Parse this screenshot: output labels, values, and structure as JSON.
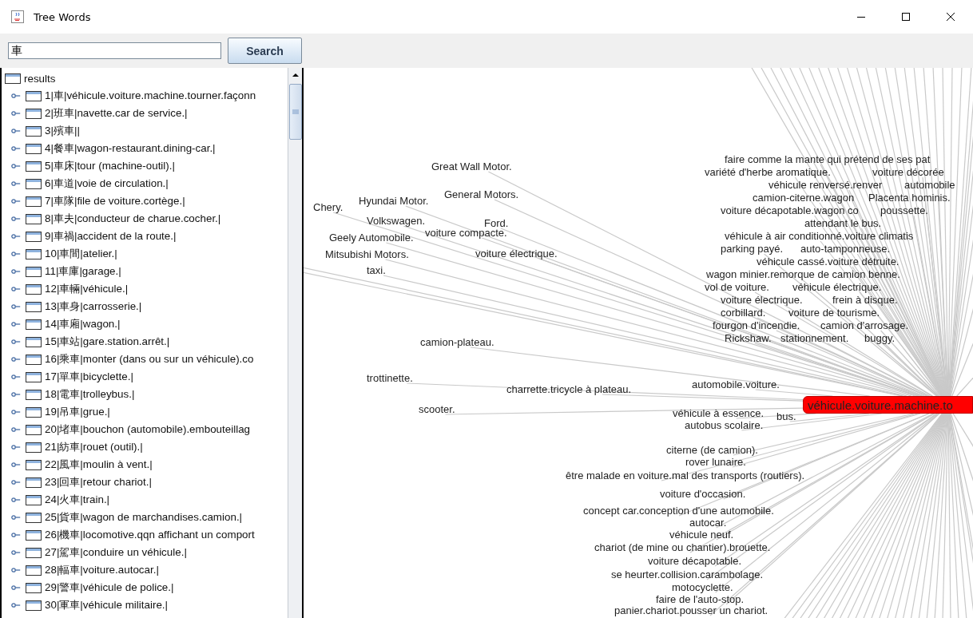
{
  "window": {
    "title": "Tree Words"
  },
  "search": {
    "value": "車",
    "button": "Search"
  },
  "tree": {
    "root": {
      "label": "results",
      "expanded": true,
      "children": [
        {
          "label": "1|車|véhicule.voiture.machine.tourner.façonn",
          "expanded": false
        },
        {
          "label": "2|班車|navette.car de service.|",
          "expanded": false
        },
        {
          "label": "3|殯車||",
          "expanded": false
        },
        {
          "label": "4|餐車|wagon-restaurant.dining-car.|",
          "expanded": false
        },
        {
          "label": "5|車床|tour (machine-outil).|",
          "expanded": false
        },
        {
          "label": "6|車道|voie de circulation.|",
          "expanded": false
        },
        {
          "label": "7|車隊|file de voiture.cortège.|",
          "expanded": false
        },
        {
          "label": "8|車夫|conducteur de charue.cocher.|",
          "expanded": false
        },
        {
          "label": "9|車禍|accident de la route.|",
          "expanded": false
        },
        {
          "label": "10|車間|atelier.|",
          "expanded": false
        },
        {
          "label": "11|車庫|garage.|",
          "expanded": false
        },
        {
          "label": "12|車輛|véhicule.|",
          "expanded": false
        },
        {
          "label": "13|車身|carrosserie.|",
          "expanded": false
        },
        {
          "label": "14|車廂|wagon.|",
          "expanded": false
        },
        {
          "label": "15|車站|gare.station.arrêt.|",
          "expanded": false
        },
        {
          "label": "16|乘車|monter (dans ou sur un véhicule).co",
          "expanded": false
        },
        {
          "label": "17|單車|bicyclette.|",
          "expanded": false
        },
        {
          "label": "18|電車|trolleybus.|",
          "expanded": false
        },
        {
          "label": "19|吊車|grue.|",
          "expanded": false
        },
        {
          "label": "20|堵車|bouchon (automobile).embouteillag",
          "expanded": false
        },
        {
          "label": "21|紡車|rouet (outil).|",
          "expanded": false
        },
        {
          "label": "22|風車|moulin à vent.|",
          "expanded": false
        },
        {
          "label": "23|回車|retour chariot.|",
          "expanded": false
        },
        {
          "label": "24|火車|train.|",
          "expanded": false
        },
        {
          "label": "25|貨車|wagon de marchandises.camion.|",
          "expanded": false
        },
        {
          "label": "26|機車|locomotive.qqn affichant un comport",
          "expanded": false
        },
        {
          "label": "27|駕車|conduire un véhicule.|",
          "expanded": false
        },
        {
          "label": "28|輻車|voiture.autocar.|",
          "expanded": false
        },
        {
          "label": "29|警車|véhicule de police.|",
          "expanded": false
        },
        {
          "label": "30|軍車|véhicule militaire.|",
          "expanded": false
        }
      ]
    }
  },
  "graph": {
    "center": "véhicule.voiture.machine.to",
    "nodes": [
      "Great Wall Motor.",
      "General Motors.",
      "Hyundai Motor.",
      "Chery.",
      "Volkswagen.",
      "Ford.",
      "voiture compacte.",
      "Geely Automobile.",
      "Mitsubishi Motors.",
      "voiture électrique.",
      "taxi.",
      "faire comme la mante qui prétend de ses pat",
      "variété d'herbe aromatique.",
      "voiture décorée",
      "automobile",
      "véhicule renversé.renver",
      "camion-citerne.wagon",
      "Placenta hominis.",
      "voiture décapotable.wagon co",
      "attendant le bus.",
      "poussette.",
      "véhicule à air conditionné.voiture climatis",
      "parking payé.",
      "auto-tamponneuse.",
      "véhicule cassé.voiture détruite.",
      "wagon minier.remorque de camion benne.",
      "vol de voiture.",
      "véhicule électrique.",
      "voiture électrique.",
      "frein à disque.",
      "corbillard.",
      "voiture de tourisme.",
      "fourgon d'incendie.",
      "camion d'arrosage.",
      "Rickshaw.",
      "stationnement.",
      "buggy.",
      "camion-plateau.",
      "trottinette.",
      "automobile.voiture.",
      "charrette.tricycle à plateau.",
      "scooter.",
      "véhicule à essence.",
      "bus.",
      "autobus scolaire.",
      "citerne (de camion).",
      "rover lunaire.",
      "être malade en voiture.mal des transports (routiers).",
      "voiture d'occasion.",
      "concept car.conception d'une automobile.",
      "autocar.",
      "véhicule neuf.",
      "chariot (de mine ou chantier).brouette.",
      "voiture décapotable.",
      "se heurter.collision.carambolage.",
      "motocyclette.",
      "faire de l'auto-stop.",
      "panier.chariot.pousser un chariot."
    ]
  }
}
